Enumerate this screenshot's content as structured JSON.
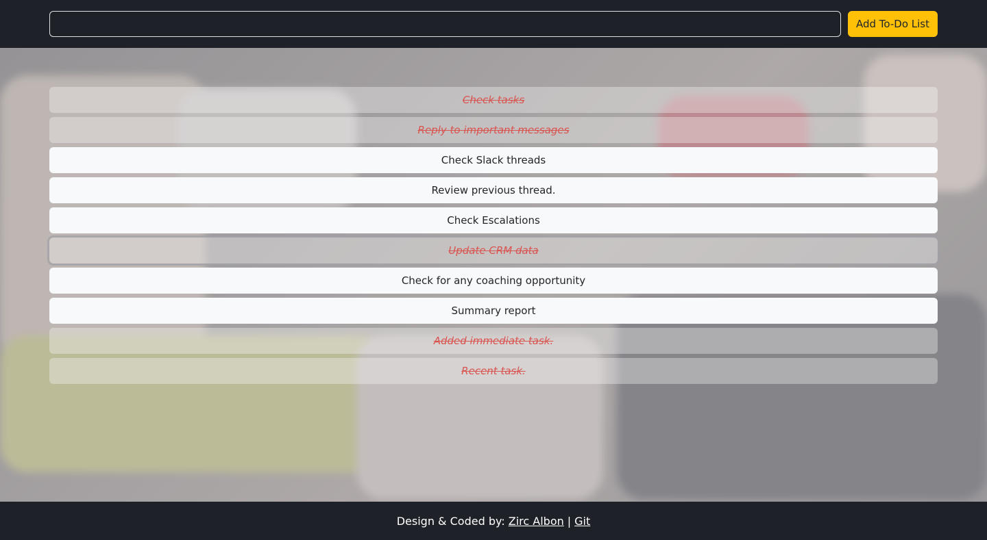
{
  "header": {
    "input_value": "",
    "input_placeholder": "",
    "add_button_label": "Add To-Do List"
  },
  "todos": [
    {
      "label": "Check tasks",
      "done": true
    },
    {
      "label": "Reply to important messages",
      "done": true
    },
    {
      "label": "Check Slack threads",
      "done": false
    },
    {
      "label": "Review previous thread.",
      "done": false
    },
    {
      "label": "Check Escalations",
      "done": false
    },
    {
      "label": "Update CRM data",
      "done": true
    },
    {
      "label": "Check for any coaching opportunity",
      "done": false
    },
    {
      "label": "Summary report",
      "done": false
    },
    {
      "label": "Added immediate task.",
      "done": true
    },
    {
      "label": "Recent task.",
      "done": true
    }
  ],
  "footer": {
    "prefix": "Design & Coded by:",
    "author_link": "Zirc Albon",
    "separator": "|",
    "git_link": "Git"
  },
  "colors": {
    "accent": "#ffc107",
    "dark": "#1e2127",
    "done_text": "#d9534f"
  }
}
